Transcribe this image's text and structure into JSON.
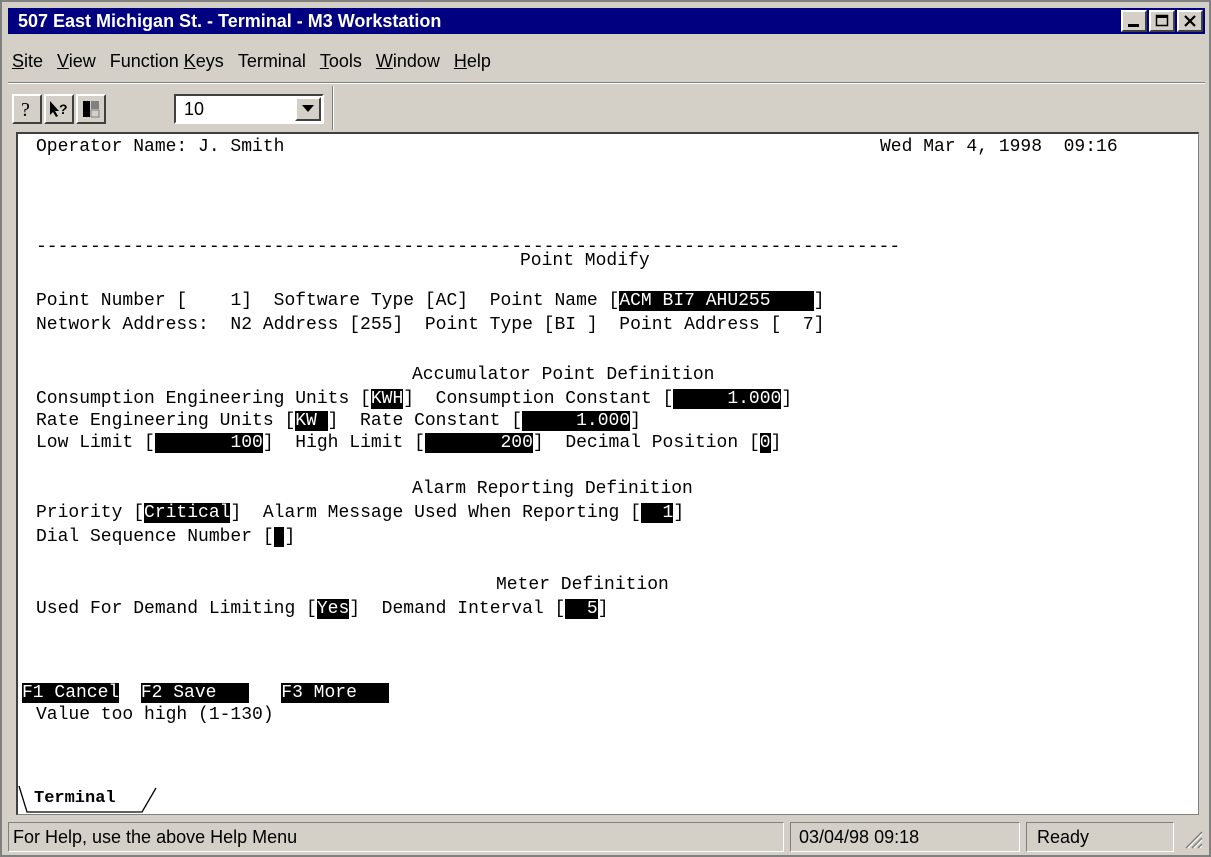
{
  "window": {
    "title": "507 East Michigan St. - Terminal - M3 Workstation"
  },
  "menu": [
    {
      "pre": "",
      "key": "S",
      "post": "ite"
    },
    {
      "pre": "",
      "key": "V",
      "post": "iew"
    },
    {
      "pre": "Function ",
      "key": "K",
      "post": "eys"
    },
    {
      "pre": "Terminal",
      "key": "",
      "post": ""
    },
    {
      "pre": "",
      "key": "T",
      "post": "ools"
    },
    {
      "pre": "",
      "key": "W",
      "post": "indow"
    },
    {
      "pre": "",
      "key": "H",
      "post": "elp"
    }
  ],
  "toolbar": {
    "buttons": [
      "help-icon",
      "context-help-icon",
      "window-layout-icon"
    ],
    "combo_value": "10"
  },
  "terminal": {
    "operator": "Operator Name: J. Smith",
    "datetime": "Wed Mar 4, 1998  09:16",
    "separator": "--------------------------------------------------------------------------------",
    "screen_title": "Point Modify",
    "point_number_label": "Point Number [",
    "point_number": "    1",
    "software_type_label": "]  Software Type [AC]  Point Name [",
    "point_name": "ACM BI7 AHU255    ",
    "network_address_line": "Network Address:  N2 Address [255]  Point Type [BI ]  Point Address [  7]",
    "accum_header": "Accumulator Point Definition",
    "cons_units_label": "Consumption Engineering Units [",
    "cons_units": "KWH",
    "cons_const_label": "]  Consumption Constant [",
    "cons_const": "     1.000",
    "rate_units_label": "Rate Engineering Units [",
    "rate_units": "KW ",
    "rate_const_label": "]  Rate Constant [",
    "rate_const": "     1.000",
    "low_limit_label": "Low Limit [",
    "low_limit": "       100",
    "high_limit_label": "]  High Limit [",
    "high_limit": "       200",
    "decimal_label": "]  Decimal Position [",
    "decimal": "0",
    "alarm_header": "Alarm Reporting Definition",
    "priority_label": "Priority [",
    "priority": "Critical",
    "alarm_msg_label": "]  Alarm Message Used When Reporting [",
    "alarm_msg": "  1",
    "dial_label": "Dial Sequence Number [",
    "dial": " ",
    "meter_header": "Meter Definition",
    "demand_label": "Used For Demand Limiting [",
    "demand": "Yes",
    "interval_label": "]  Demand Interval [",
    "interval": "  5",
    "close_bracket": "]",
    "fkey1": "F1 Cancel",
    "fkey2": "F2 Save   ",
    "fkey3": "F3 More   ",
    "message": "Value too high (1-130)"
  },
  "tabs": {
    "terminal": "Terminal"
  },
  "status": {
    "help": "For Help, use the above Help Menu",
    "datetime": "03/04/98 09:18",
    "state": "Ready"
  }
}
